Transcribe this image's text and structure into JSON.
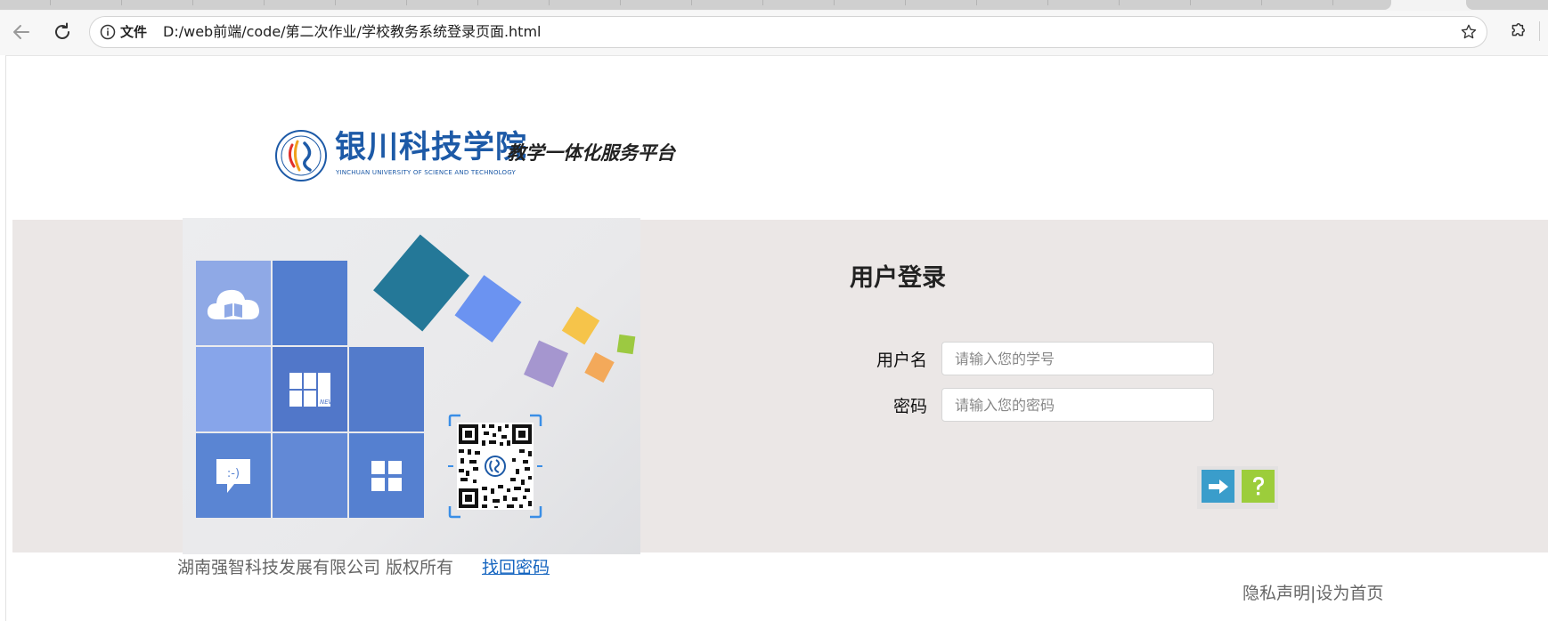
{
  "browser": {
    "file_chip": "文件",
    "url": "D:/web前端/code/第二次作业/学校教务系统登录页面.html"
  },
  "header": {
    "logo_cn": "银川科技学院",
    "logo_en": "YINCHUAN UNIVERSITY OF SCIENCE AND TECHNOLOGY",
    "platform": "教学一体化服务平台"
  },
  "banner": {
    "tiles": [
      {
        "color": "#8fa9e6",
        "icon": "cloud-book-icon"
      },
      {
        "color": "#537ecf",
        "icon": ""
      },
      {
        "color": "#87a5ea",
        "icon": ""
      },
      {
        "color": "#5177c9",
        "icon": "news-icon"
      },
      {
        "color": "#537bcb",
        "icon": ""
      },
      {
        "color": "#5a85d3",
        "icon": "chat-icon"
      },
      {
        "color": "#6289d6",
        "icon": ""
      },
      {
        "color": "#5580d0",
        "icon": "grid-icon"
      }
    ],
    "news_label": "NEWS",
    "chat_label": ":-)",
    "colors": {
      "teal": "#247898",
      "blue": "#6b93f1",
      "yellow": "#f6c44a",
      "purple": "#a596cf",
      "orange": "#f3a95a",
      "green": "#9cc941"
    }
  },
  "login": {
    "title": "用户登录",
    "username_label": "用户名",
    "username_placeholder": "请输入您的学号",
    "password_label": "密码",
    "password_placeholder": "请输入您的密码",
    "login_icon": "arrow-right-icon",
    "help_icon": "question-mark-icon"
  },
  "footer": {
    "copyright": "湖南强智科技发展有限公司 版权所有",
    "forgot_password": "找回密码",
    "privacy": "隐私声明",
    "divider": "|",
    "set_homepage": "设为首页"
  }
}
